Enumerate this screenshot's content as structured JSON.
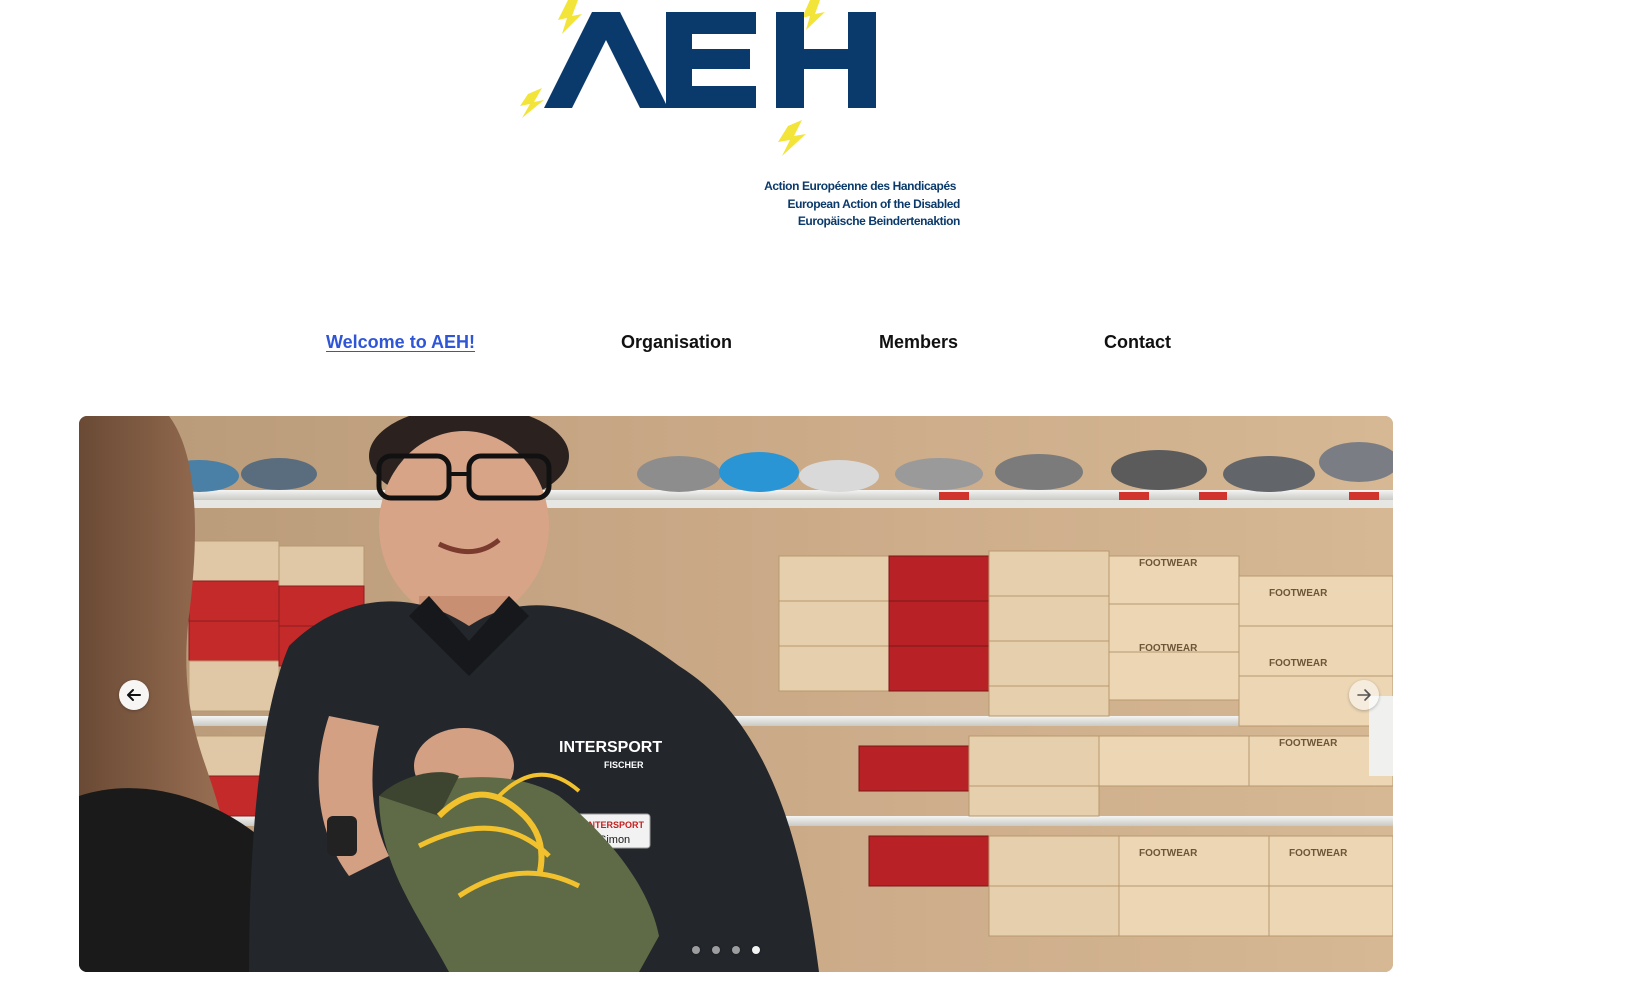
{
  "logo": {
    "wordmark": "AEH",
    "subtitle_lines": [
      "Action Européenne des Handicapés",
      "European Action of the Disabled",
      "Europäische Beindertenaktion"
    ],
    "brand_color": "#0a3a6b",
    "accent_color": "#f3e43a"
  },
  "nav": {
    "items": [
      {
        "label": "Welcome to AEH!",
        "active": true
      },
      {
        "label": "Organisation",
        "active": false
      },
      {
        "label": "Members",
        "active": false
      },
      {
        "label": "Contact",
        "active": false
      }
    ],
    "active_color": "#2f56d6"
  },
  "slider": {
    "prev_icon": "arrow-left-icon",
    "next_icon": "arrow-right-icon",
    "slide_count": 4,
    "active_index": 3,
    "photo_text": {
      "shirt_brand": "INTERSPORT",
      "shirt_sub": "FISCHER",
      "name_badge_brand": "INTERSPORT",
      "name_badge_name": "Simon",
      "box_label": "FOOTWEAR"
    }
  }
}
